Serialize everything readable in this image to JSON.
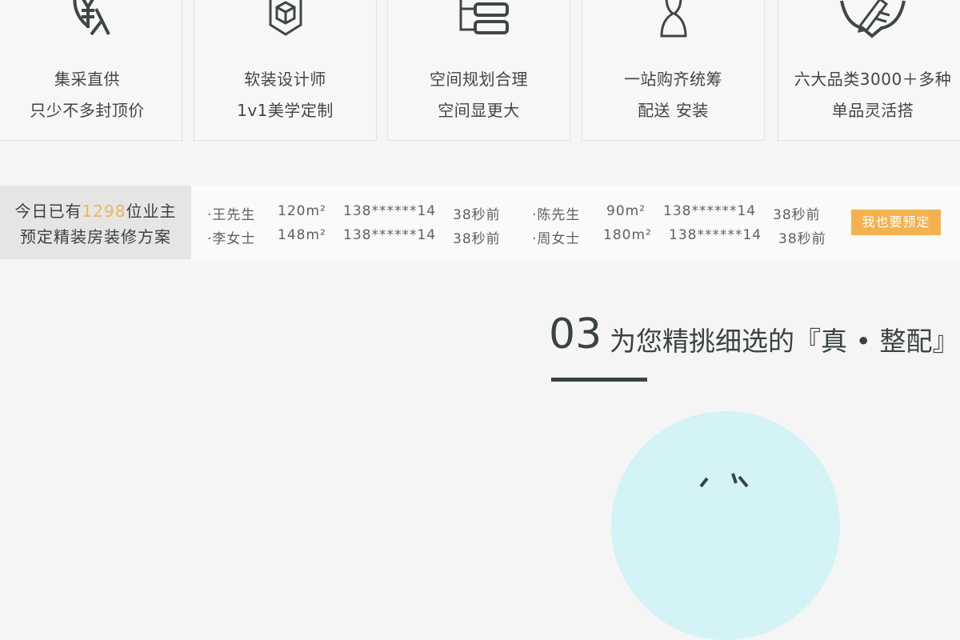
{
  "features": [
    {
      "icon": "money-person-icon",
      "line1": "集采直供",
      "line2": "只少不多封顶价"
    },
    {
      "icon": "cube-icon",
      "line1": "软装设计师",
      "line2": "1v1美学定制"
    },
    {
      "icon": "layout-blocks-icon",
      "line1": "空间规划合理",
      "line2": "空间显更大"
    },
    {
      "icon": "mannequin-icon",
      "line1": "一站购齐统筹",
      "line2": "配送 安装"
    },
    {
      "icon": "pencil-ruler-badge-icon",
      "line1": "六大品类3000＋多种",
      "line2": "单品灵活搭"
    }
  ],
  "booking": {
    "prefix": "今日已有",
    "count": "1298",
    "suffix": "位业主",
    "line2": "预定精装房装修方案",
    "records": [
      {
        "name": "·王先生",
        "area": "120m²",
        "phone": "138******14",
        "time": "38秒前"
      },
      {
        "name": "·陈先生",
        "area": "90m²",
        "phone": "138******14",
        "time": "38秒前"
      },
      {
        "name": "·李女士",
        "area": "148m²",
        "phone": "138******14",
        "time": "38秒前"
      },
      {
        "name": "·周女士",
        "area": "180m²",
        "phone": "138******14",
        "time": "38秒前"
      }
    ],
    "button": "我也要预定"
  },
  "section": {
    "number": "03",
    "title": "为您精挑细选的『真 • 整配』"
  },
  "colors": {
    "accent": "#f3b24f",
    "text": "#3a4243",
    "circle": "#d3f3f6"
  }
}
